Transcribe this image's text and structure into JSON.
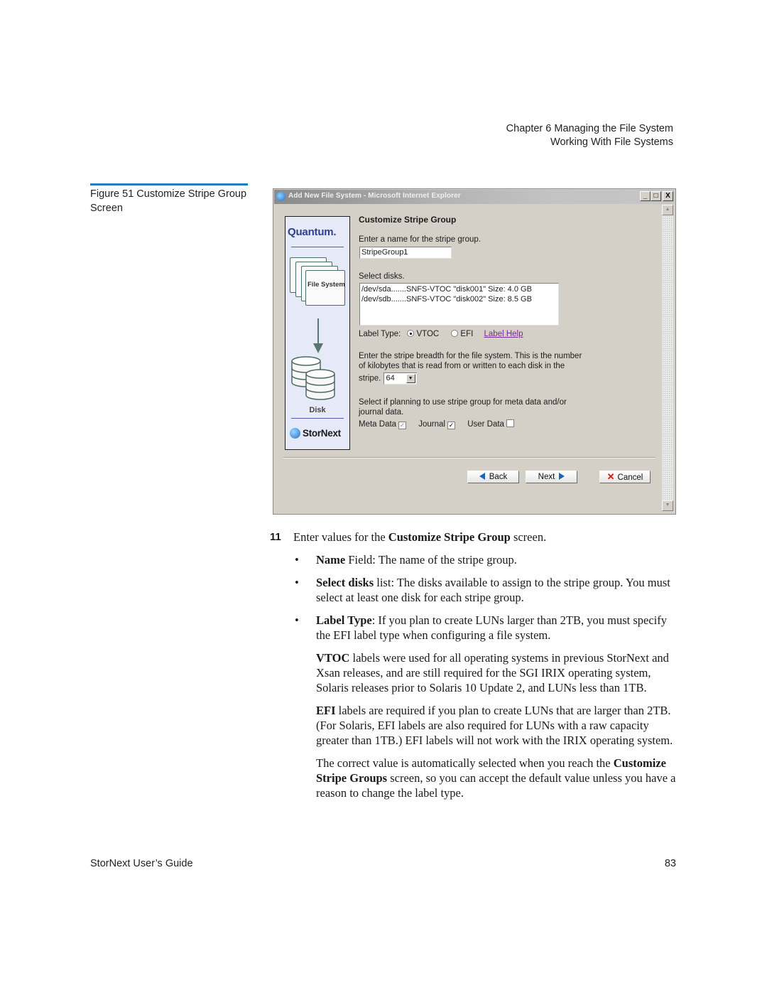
{
  "running_head": {
    "line1": "Chapter 6  Managing the File System",
    "line2": "Working With File Systems"
  },
  "figure": {
    "caption": "Figure 51  Customize Stripe Group Screen"
  },
  "window": {
    "title": "Add New File System - Microsoft Internet Explorer",
    "controls": {
      "minimize": "_",
      "maximize": "□",
      "close": "X"
    },
    "sidebar": {
      "brand": "Quantum.",
      "folder_label": "File System",
      "disk_label": "Disk",
      "product": "StorNext"
    },
    "form": {
      "heading": "Customize Stripe Group",
      "name_prompt": "Enter a name for the stripe group.",
      "name_value": "StripeGroup1",
      "disks_prompt": "Select disks.",
      "disks": [
        "/dev/sda.......SNFS-VTOC \"disk001\" Size: 4.0 GB",
        "/dev/sdb.......SNFS-VTOC \"disk002\" Size: 8.5 GB"
      ],
      "label_type_label": "Label Type:",
      "label_type_options": [
        "VTOC",
        "EFI"
      ],
      "label_type_selected": "VTOC",
      "label_help": "Label Help",
      "breadth_prompt_1": "Enter the stripe breadth for the file system. This is the number",
      "breadth_prompt_2": "of kilobytes that is read from or written to each disk in the",
      "breadth_prompt_3": "stripe.",
      "breadth_value": "64",
      "usage_prompt_1": "Select if planning to use stripe group for meta data and/or",
      "usage_prompt_2": "journal data.",
      "checkboxes": [
        {
          "label": "Meta Data",
          "checked": true,
          "disabled": true
        },
        {
          "label": "Journal",
          "checked": true,
          "disabled": false
        },
        {
          "label": "User Data",
          "checked": false,
          "disabled": false
        }
      ]
    },
    "buttons": {
      "back": "Back",
      "next": "Next",
      "cancel": "Cancel"
    }
  },
  "body": {
    "step_number": "11",
    "step_pre": "Enter values for the ",
    "step_bold": "Customize Stripe Group",
    "step_post": " screen.",
    "bullets": [
      {
        "bold": "Name",
        "text": " Field: The name of the stripe group."
      },
      {
        "bold": "Select disks",
        "text": " list: The disks available to assign to the stripe group. You must select at least one disk for each stripe group."
      },
      {
        "bold": "Label Type",
        "text": ": If you plan to create LUNs larger than 2TB, you must specify the EFI label type when configuring a file system."
      }
    ],
    "para_vtoc_bold": "VTOC",
    "para_vtoc_text": " labels were used for all operating systems in previous StorNext and Xsan releases, and are still required for the SGI IRIX operating system, Solaris releases prior to Solaris 10 Update 2, and LUNs less than 1TB.",
    "para_efi_bold": "EFI",
    "para_efi_text": " labels are required if you plan to create LUNs that are larger than 2TB. (For Solaris, EFI labels are also required for LUNs with a raw capacity greater than 1TB.) EFI labels will not work with the IRIX operating system.",
    "para_default_pre": "The correct value is automatically selected when you reach the ",
    "para_default_bold": "Customize Stripe Groups",
    "para_default_post": " screen, so you can accept the default value unless you have a reason to change the label type."
  },
  "footer": {
    "title": "StorNext User’s Guide",
    "page": "83"
  }
}
